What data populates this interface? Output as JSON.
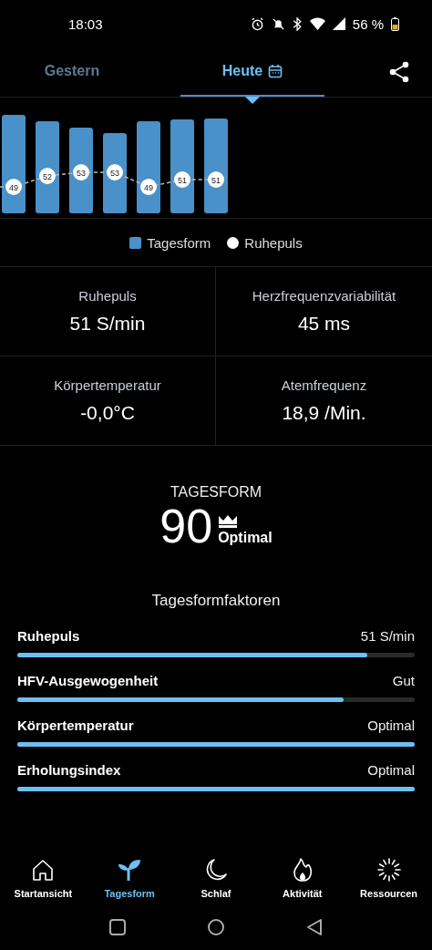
{
  "status_bar": {
    "time": "18:03",
    "battery": "56 %"
  },
  "tabs": [
    {
      "label": "Gestern",
      "selected": false
    },
    {
      "label": "Heute",
      "selected": true
    }
  ],
  "chart_points": [
    "49",
    "52",
    "53",
    "53",
    "49",
    "51",
    "51"
  ],
  "legend": [
    {
      "label": "Tagesform",
      "kind": "square"
    },
    {
      "label": "Ruhepuls",
      "kind": "dot"
    }
  ],
  "metrics": [
    {
      "label": "Ruhepuls",
      "value": "51 S/min"
    },
    {
      "label": "Herzfrequenzvariabilität",
      "value": "45 ms"
    },
    {
      "label": "Körpertemperatur",
      "value": "-0,0°C"
    },
    {
      "label": "Atemfrequenz",
      "value": "18,9 /Min."
    }
  ],
  "score": {
    "title": "TAGESFORM",
    "value": "90",
    "rating": "Optimal"
  },
  "factors_title": "Tagesformfaktoren",
  "factors": [
    {
      "label": "Ruhepuls",
      "value": "51 S/min",
      "level": 0.88
    },
    {
      "label": "HFV-Ausgewogenheit",
      "value": "Gut",
      "level": 0.82
    },
    {
      "label": "Körpertemperatur",
      "value": "Optimal",
      "level": 1
    },
    {
      "label": "Erholungsindex",
      "value": "Optimal",
      "level": 1
    }
  ],
  "nav": [
    {
      "label": "Startansicht",
      "kind": "home",
      "selected": false
    },
    {
      "label": "Tagesform",
      "kind": "sprout",
      "selected": true
    },
    {
      "label": "Schlaf",
      "kind": "moon",
      "selected": false
    },
    {
      "label": "Aktivität",
      "kind": "flame",
      "selected": false
    },
    {
      "label": "Ressourcen",
      "kind": "burst",
      "selected": false
    }
  ]
}
